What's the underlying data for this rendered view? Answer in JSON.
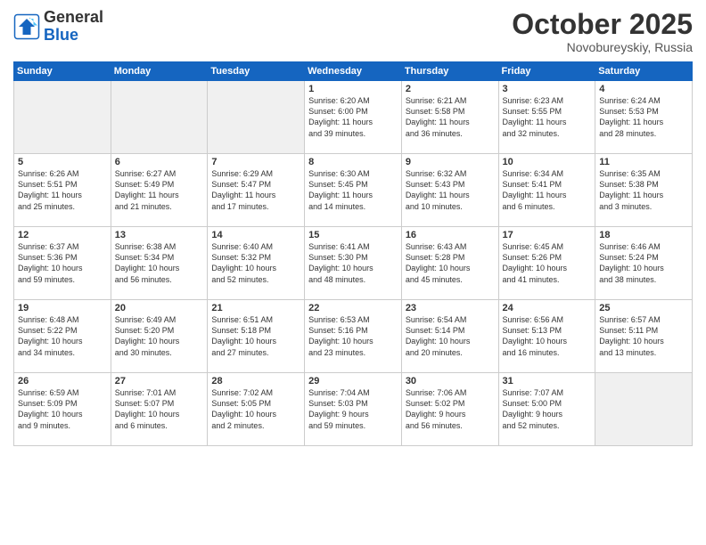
{
  "logo": {
    "general": "General",
    "blue": "Blue"
  },
  "header": {
    "month": "October 2025",
    "location": "Novobureyskiy, Russia"
  },
  "weekdays": [
    "Sunday",
    "Monday",
    "Tuesday",
    "Wednesday",
    "Thursday",
    "Friday",
    "Saturday"
  ],
  "weeks": [
    [
      {
        "day": "",
        "info": ""
      },
      {
        "day": "",
        "info": ""
      },
      {
        "day": "",
        "info": ""
      },
      {
        "day": "1",
        "info": "Sunrise: 6:20 AM\nSunset: 6:00 PM\nDaylight: 11 hours\nand 39 minutes."
      },
      {
        "day": "2",
        "info": "Sunrise: 6:21 AM\nSunset: 5:58 PM\nDaylight: 11 hours\nand 36 minutes."
      },
      {
        "day": "3",
        "info": "Sunrise: 6:23 AM\nSunset: 5:55 PM\nDaylight: 11 hours\nand 32 minutes."
      },
      {
        "day": "4",
        "info": "Sunrise: 6:24 AM\nSunset: 5:53 PM\nDaylight: 11 hours\nand 28 minutes."
      }
    ],
    [
      {
        "day": "5",
        "info": "Sunrise: 6:26 AM\nSunset: 5:51 PM\nDaylight: 11 hours\nand 25 minutes."
      },
      {
        "day": "6",
        "info": "Sunrise: 6:27 AM\nSunset: 5:49 PM\nDaylight: 11 hours\nand 21 minutes."
      },
      {
        "day": "7",
        "info": "Sunrise: 6:29 AM\nSunset: 5:47 PM\nDaylight: 11 hours\nand 17 minutes."
      },
      {
        "day": "8",
        "info": "Sunrise: 6:30 AM\nSunset: 5:45 PM\nDaylight: 11 hours\nand 14 minutes."
      },
      {
        "day": "9",
        "info": "Sunrise: 6:32 AM\nSunset: 5:43 PM\nDaylight: 11 hours\nand 10 minutes."
      },
      {
        "day": "10",
        "info": "Sunrise: 6:34 AM\nSunset: 5:41 PM\nDaylight: 11 hours\nand 6 minutes."
      },
      {
        "day": "11",
        "info": "Sunrise: 6:35 AM\nSunset: 5:38 PM\nDaylight: 11 hours\nand 3 minutes."
      }
    ],
    [
      {
        "day": "12",
        "info": "Sunrise: 6:37 AM\nSunset: 5:36 PM\nDaylight: 10 hours\nand 59 minutes."
      },
      {
        "day": "13",
        "info": "Sunrise: 6:38 AM\nSunset: 5:34 PM\nDaylight: 10 hours\nand 56 minutes."
      },
      {
        "day": "14",
        "info": "Sunrise: 6:40 AM\nSunset: 5:32 PM\nDaylight: 10 hours\nand 52 minutes."
      },
      {
        "day": "15",
        "info": "Sunrise: 6:41 AM\nSunset: 5:30 PM\nDaylight: 10 hours\nand 48 minutes."
      },
      {
        "day": "16",
        "info": "Sunrise: 6:43 AM\nSunset: 5:28 PM\nDaylight: 10 hours\nand 45 minutes."
      },
      {
        "day": "17",
        "info": "Sunrise: 6:45 AM\nSunset: 5:26 PM\nDaylight: 10 hours\nand 41 minutes."
      },
      {
        "day": "18",
        "info": "Sunrise: 6:46 AM\nSunset: 5:24 PM\nDaylight: 10 hours\nand 38 minutes."
      }
    ],
    [
      {
        "day": "19",
        "info": "Sunrise: 6:48 AM\nSunset: 5:22 PM\nDaylight: 10 hours\nand 34 minutes."
      },
      {
        "day": "20",
        "info": "Sunrise: 6:49 AM\nSunset: 5:20 PM\nDaylight: 10 hours\nand 30 minutes."
      },
      {
        "day": "21",
        "info": "Sunrise: 6:51 AM\nSunset: 5:18 PM\nDaylight: 10 hours\nand 27 minutes."
      },
      {
        "day": "22",
        "info": "Sunrise: 6:53 AM\nSunset: 5:16 PM\nDaylight: 10 hours\nand 23 minutes."
      },
      {
        "day": "23",
        "info": "Sunrise: 6:54 AM\nSunset: 5:14 PM\nDaylight: 10 hours\nand 20 minutes."
      },
      {
        "day": "24",
        "info": "Sunrise: 6:56 AM\nSunset: 5:13 PM\nDaylight: 10 hours\nand 16 minutes."
      },
      {
        "day": "25",
        "info": "Sunrise: 6:57 AM\nSunset: 5:11 PM\nDaylight: 10 hours\nand 13 minutes."
      }
    ],
    [
      {
        "day": "26",
        "info": "Sunrise: 6:59 AM\nSunset: 5:09 PM\nDaylight: 10 hours\nand 9 minutes."
      },
      {
        "day": "27",
        "info": "Sunrise: 7:01 AM\nSunset: 5:07 PM\nDaylight: 10 hours\nand 6 minutes."
      },
      {
        "day": "28",
        "info": "Sunrise: 7:02 AM\nSunset: 5:05 PM\nDaylight: 10 hours\nand 2 minutes."
      },
      {
        "day": "29",
        "info": "Sunrise: 7:04 AM\nSunset: 5:03 PM\nDaylight: 9 hours\nand 59 minutes."
      },
      {
        "day": "30",
        "info": "Sunrise: 7:06 AM\nSunset: 5:02 PM\nDaylight: 9 hours\nand 56 minutes."
      },
      {
        "day": "31",
        "info": "Sunrise: 7:07 AM\nSunset: 5:00 PM\nDaylight: 9 hours\nand 52 minutes."
      },
      {
        "day": "",
        "info": ""
      }
    ]
  ]
}
